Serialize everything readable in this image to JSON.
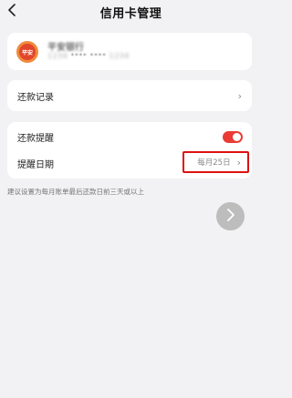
{
  "nav": {
    "title": "信用卡管理",
    "back_icon": "chevron-left-icon"
  },
  "bank_card": {
    "logo_icon": "bank-logo-icon",
    "logo_text": "平安",
    "name": "平安银行",
    "number_mask": "**** ****",
    "number_hidden": "1234"
  },
  "repayment_record": {
    "label": "还款记录",
    "chevron": "›"
  },
  "reminder": {
    "label": "还款提醒",
    "enabled": true,
    "accent": "#ea3b35"
  },
  "reminder_date": {
    "label": "提醒日期",
    "value": "每月25日",
    "chevron": "›",
    "highlight_color": "#e01010"
  },
  "hint": {
    "text": "建议设置为每月账单最后还款日前三天或以上"
  },
  "floating_button": {
    "icon": "chevron-right-icon"
  }
}
